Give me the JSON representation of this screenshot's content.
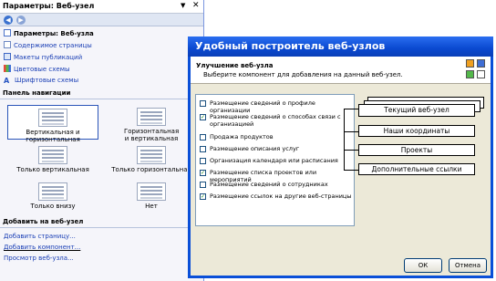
{
  "taskpane": {
    "title": "Параметры: Веб-узел",
    "links": [
      {
        "label": "Параметры: Веб-узла",
        "icon": "web-doc-icon",
        "heading": true
      },
      {
        "label": "Содержимое страницы",
        "icon": "page-icon"
      },
      {
        "label": "Макеты публикаций",
        "icon": "layout-icon"
      },
      {
        "label": "Цветовые схемы",
        "icon": "color-scheme-icon"
      },
      {
        "label": "Шрифтовые схемы",
        "icon": "font-scheme-icon"
      }
    ],
    "nav_section_title": "Панель навигации",
    "nav_options": [
      {
        "label": "Вертикальная и горизонтальная",
        "selected": true
      },
      {
        "label": "Горизонтальная и вертикальная",
        "selected": false
      },
      {
        "label": "Только вертикальная",
        "selected": false
      },
      {
        "label": "Только горизонтальная",
        "selected": false
      },
      {
        "label": "Только внизу",
        "selected": false
      },
      {
        "label": "Нет",
        "selected": false
      }
    ],
    "add_section_title": "Добавить на веб-узел",
    "add_links": [
      "Добавить страницу...",
      "Добавить компонент...",
      "Просмотр веб-узла..."
    ]
  },
  "dialog": {
    "title": "Удобный построитель веб-узлов",
    "header_title": "Улучшение веб-узла",
    "header_subtitle": "Выберите компонент для добавления на данный веб-узел.",
    "checklist": [
      {
        "label": "Размещение сведений о профиле организации",
        "checked": false
      },
      {
        "label": "Размещение сведений о способах связи с организацией",
        "checked": true
      },
      {
        "label": "Продажа продуктов",
        "checked": false
      },
      {
        "label": "Размещение описания услуг",
        "checked": false
      },
      {
        "label": "Организация календаря или расписания",
        "checked": false
      },
      {
        "label": "Размещение списка проектов или мероприятий",
        "checked": true
      },
      {
        "label": "Размещение сведений о сотрудниках",
        "checked": false
      },
      {
        "label": "Размещение ссылок на другие веб-страницы",
        "checked": true
      }
    ],
    "pages": [
      "Текущий веб-узел",
      "Наши координаты",
      "Проекты",
      "Дополнительные ссылки"
    ],
    "ok_label": "ОК",
    "cancel_label": "Отмена"
  },
  "colors": {
    "titlebar": "#0a49d0",
    "dialog_face": "#ece9d8",
    "link": "#1a3fb5",
    "taskpane_bg": "#f5f5fa"
  }
}
